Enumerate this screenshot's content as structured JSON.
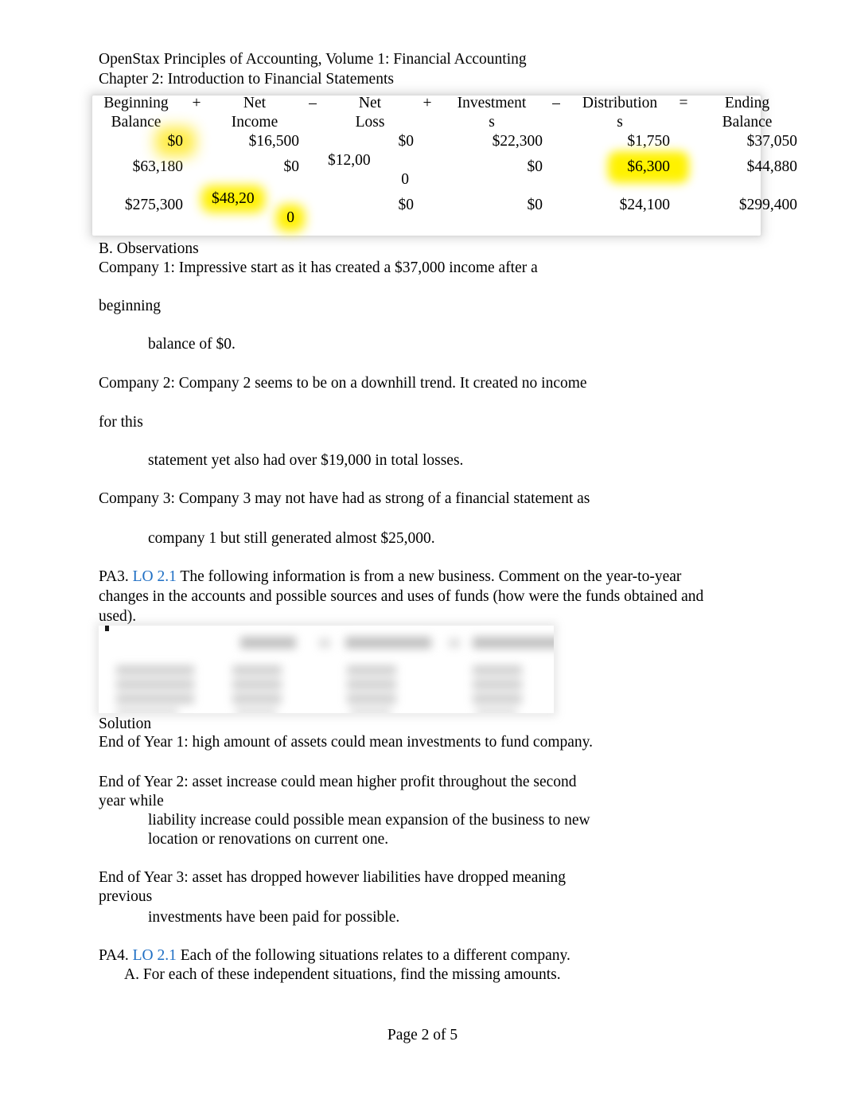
{
  "document": {
    "header_line1": "OpenStax Principles of Accounting, Volume 1: Financial Accounting",
    "header_line2": "Chapter 2: Introduction to Financial Statements",
    "footer": "Page 2 of 5"
  },
  "equation_table": {
    "headers": [
      "Beginning Balance",
      "Net Income",
      "Net Loss",
      "Investments",
      "Distributions",
      "Ending Balance"
    ],
    "header_lines": {
      "beginning": [
        "Beginning",
        "Balance"
      ],
      "net_income": [
        "Net",
        "Income"
      ],
      "net_loss": [
        "Net",
        "Loss"
      ],
      "investments": [
        "Investment",
        "s"
      ],
      "distributions": [
        "Distribution",
        "s"
      ],
      "ending": [
        "Ending",
        "Balance"
      ]
    },
    "operators": [
      "+",
      "–",
      "+",
      "–",
      "="
    ],
    "rows": [
      {
        "beginning_balance": "$0",
        "net_income": "$16,500",
        "net_loss": "$0",
        "investments": "$22,300",
        "distributions": "$1,750",
        "ending_balance": "$37,050",
        "highlight": [
          "beginning_balance"
        ]
      },
      {
        "beginning_balance": "$63,180",
        "net_income": "$0",
        "net_loss": "$12,000",
        "net_loss_line1": "$12,00",
        "net_loss_line2": "0",
        "investments": "$0",
        "distributions": "$6,300",
        "ending_balance": "$44,880",
        "highlight": [
          "distributions"
        ]
      },
      {
        "beginning_balance": "$275,300",
        "net_income": "$48,200",
        "net_income_line1": "$48,20",
        "net_income_line2": "0",
        "net_loss": "$0",
        "investments": "$0",
        "distributions": "$24,100",
        "ending_balance": "$299,400",
        "highlight": [
          "net_income"
        ]
      }
    ],
    "highlight_color": "#fff000"
  },
  "observations": {
    "heading": "B. Observations",
    "company1_line1": "Company 1: Impressive start as it has created a $37,000 income after a",
    "company1_line2": "beginning",
    "company1_line3": "balance of $0.",
    "company2_line1": "Company 2: Company 2 seems to be on a downhill trend. It created no income",
    "company2_line2": "for this",
    "company2_line3": "statement yet also had over $19,000 in total losses.",
    "company3_line1": "Company 3: Company 3 may not have had as strong of a financial statement as",
    "company3_line2": "company 1 but still generated almost $25,000."
  },
  "pa3": {
    "label": "PA3.",
    "lo": "LO 2.1",
    "text_line1": "The following information is from a new business. Comment on the year-to-year",
    "text_line2": "changes in the accounts and possible sources and uses of funds (how were the funds obtained and",
    "text_line3": "used).",
    "figure_alt": "blurred accounting equation table image"
  },
  "solution": {
    "heading": "Solution",
    "year1": "End of Year 1:  high amount of assets could mean investments to fund company.",
    "year2_line1": "End of Year 2: asset increase could mean higher profit throughout the second",
    "year2_line2": "year while",
    "year2_line3": "liability increase could possible mean expansion of the business to new",
    "year2_line4": "location or renovations on current one.",
    "year3_line1": "End of Year 3: asset has dropped however liabilities have dropped meaning",
    "year3_line2": "previous",
    "year3_line3": "investments have been paid for possible."
  },
  "pa4": {
    "label": "PA4.",
    "lo": "LO 2.1",
    "text": "Each of the following situations relates to a different company.",
    "item_a": "A.  For each of these independent situations, find the missing amounts."
  },
  "colors": {
    "link_blue": "#1f6fc4",
    "highlight_yellow": "#fff000",
    "text": "#000000"
  }
}
